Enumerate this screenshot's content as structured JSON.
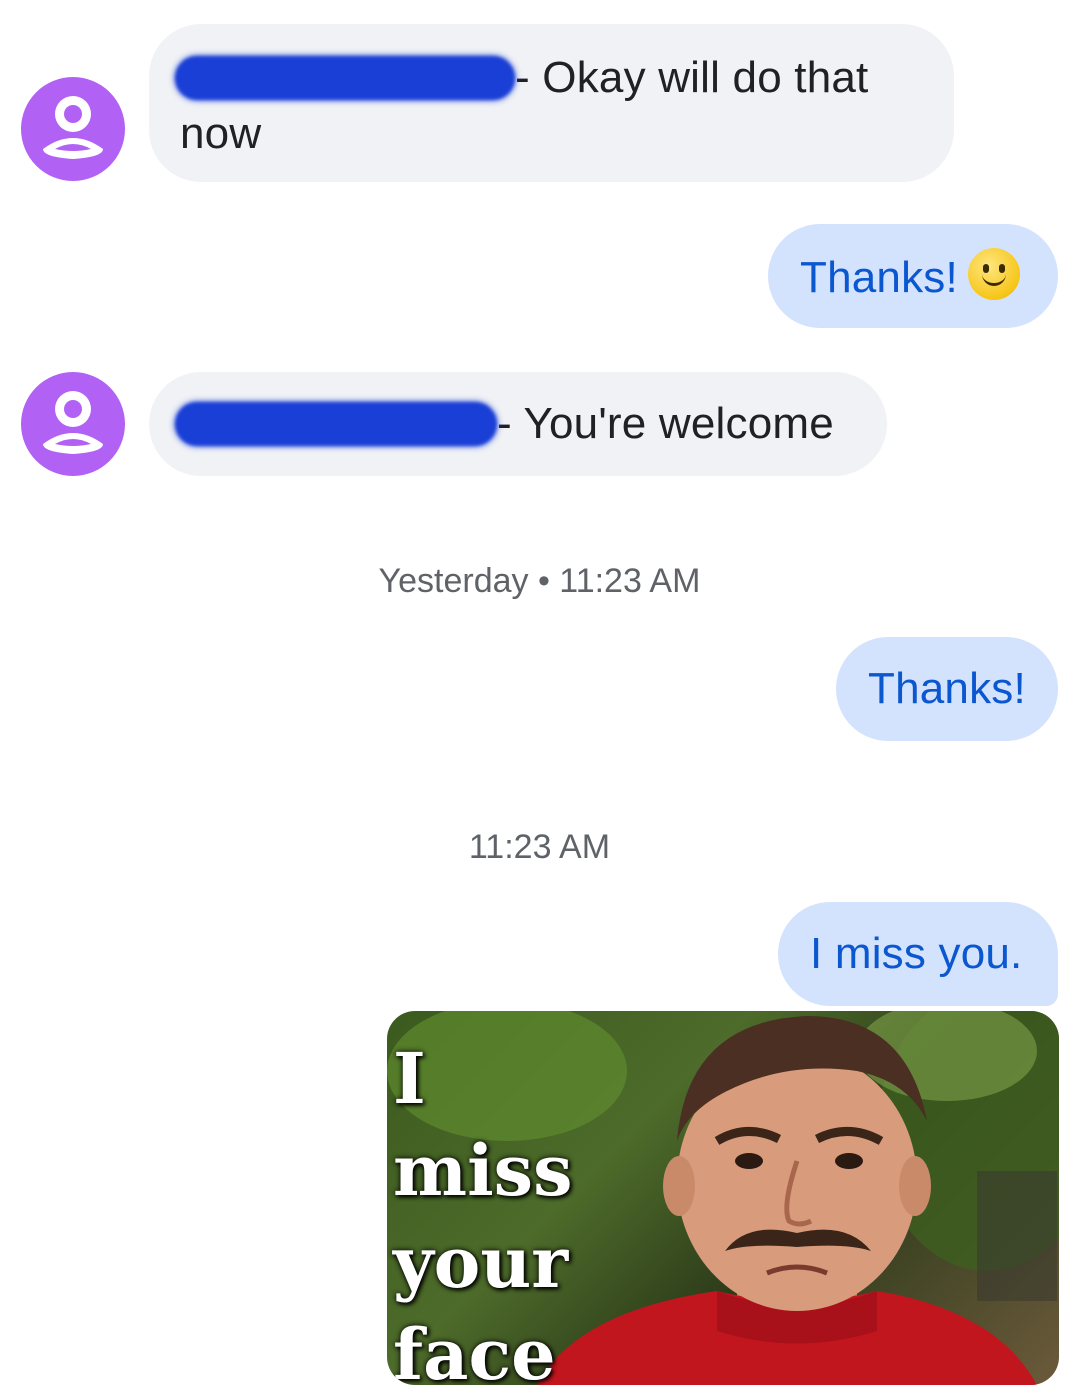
{
  "messages": {
    "m1": {
      "text_line1": "- Okay will do that",
      "text_line2": "now"
    },
    "m2": {
      "text": "Thanks!"
    },
    "m3": {
      "text": "- You're welcome"
    },
    "timestamp1": "Yesterday • 11:23 AM",
    "m4": {
      "text": "Thanks!"
    },
    "timestamp2": "11:23 AM",
    "m5": {
      "text": "I miss you."
    },
    "gif": {
      "caption": "I miss\nyour\nface"
    }
  },
  "icons": {
    "avatar": "person-icon",
    "emoji": "slightly-smiling-face-icon"
  },
  "colors": {
    "avatar_bg": "#b162f5",
    "incoming_bubble": "#f0f2f5",
    "outgoing_bubble": "#d3e3fd",
    "outgoing_text": "#0b57d0",
    "redaction": "#1a3fd6"
  }
}
